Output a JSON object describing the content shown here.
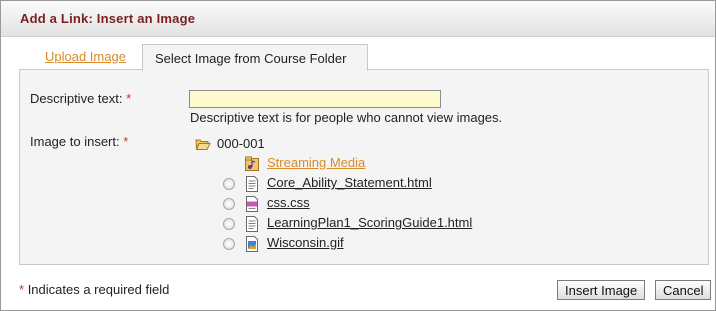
{
  "dialog": {
    "title": "Add a Link: Insert an Image"
  },
  "tabs": {
    "upload": "Upload Image",
    "select": "Select Image from Course Folder"
  },
  "form": {
    "descriptive_label": "Descriptive text:",
    "required_mark": "*",
    "descriptive_value": "",
    "descriptive_hint": "Descriptive text is for people who cannot view images.",
    "image_label": "Image to insert:"
  },
  "tree": {
    "root_icon": "open-folder-icon",
    "root": "000-001",
    "items": [
      {
        "name": "Streaming Media",
        "type": "folder",
        "icon": "media-folder-icon",
        "selectable": false
      },
      {
        "name": "Core_Ability_Statement.html",
        "type": "file",
        "icon": "html-file-icon",
        "selectable": true
      },
      {
        "name": "css.css",
        "type": "file",
        "icon": "css-file-icon",
        "selectable": true
      },
      {
        "name": "LearningPlan1_ScoringGuide1.html",
        "type": "file",
        "icon": "html-file-icon",
        "selectable": true
      },
      {
        "name": "Wisconsin.gif",
        "type": "file",
        "icon": "image-file-icon",
        "selectable": true
      }
    ]
  },
  "footer": {
    "required_mark": "*",
    "required_note": "Indicates a required field",
    "insert_label": "Insert Image",
    "cancel_label": "Cancel"
  },
  "colors": {
    "title": "#7a1f1f",
    "link_orange": "#d98a2b",
    "input_bg": "#fffacd",
    "required_red": "#c0392b"
  }
}
